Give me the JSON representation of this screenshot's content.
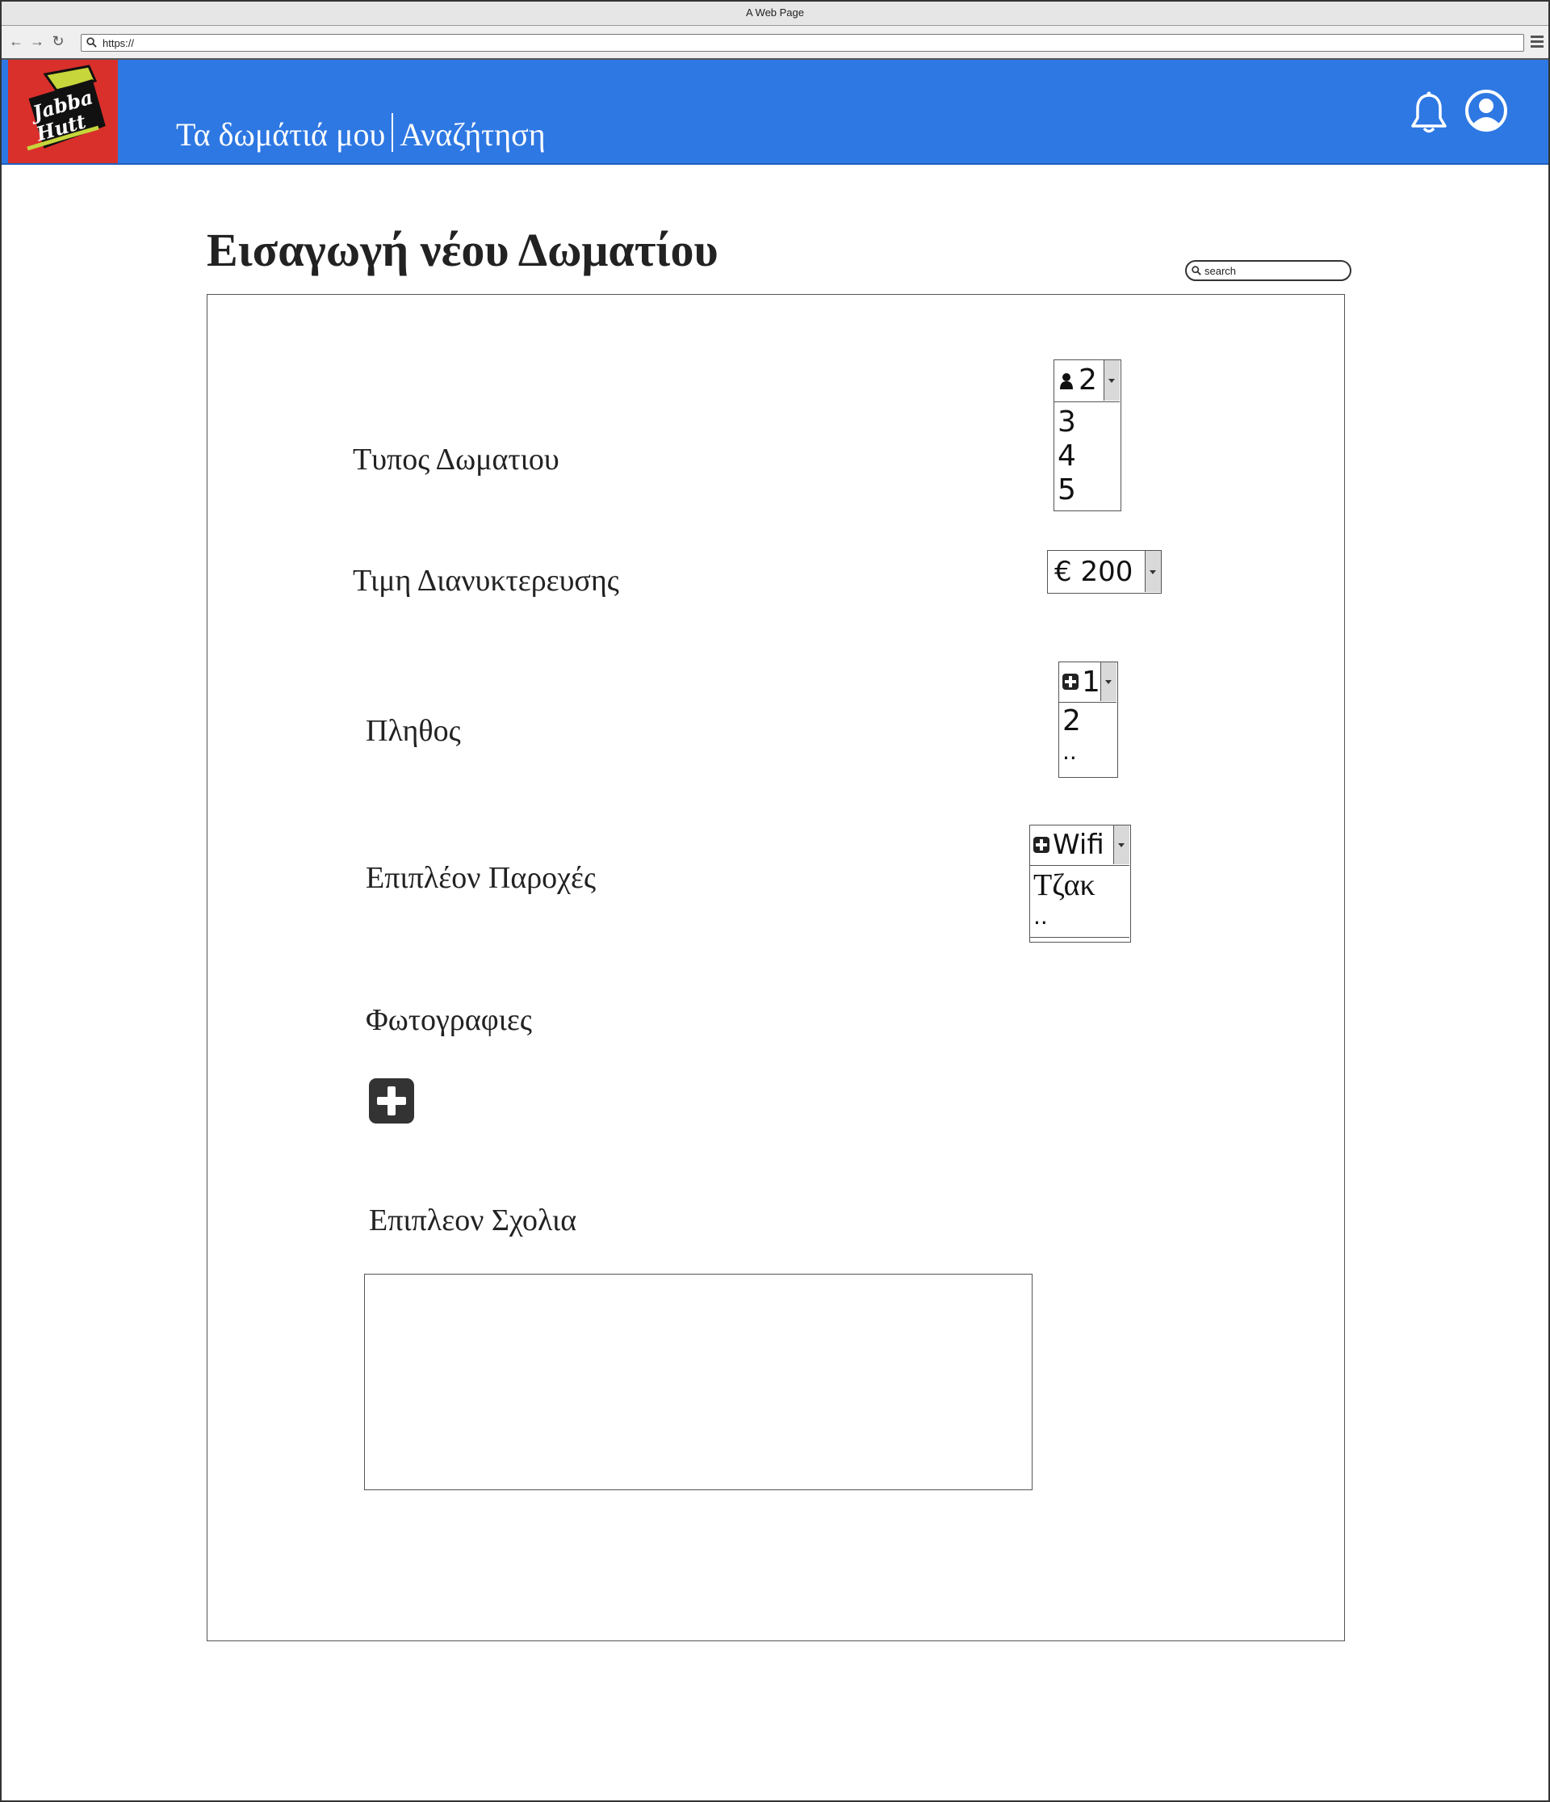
{
  "browser": {
    "window_title": "A Web Page",
    "url": "https://"
  },
  "header": {
    "logo_text": "Jabba Hutt",
    "nav": [
      "Τα δωμάτιά μου",
      "Αναζήτηση"
    ],
    "icons": [
      "bell-icon",
      "user-account-icon"
    ],
    "brand_color": "#2e78e3",
    "logo_color": "#d9302b"
  },
  "page": {
    "title": "Εισαγωγή νέου Δωματίου",
    "search_placeholder": "search"
  },
  "form": {
    "room_type": {
      "label": "Τυπος Δωματιου",
      "icon": "person-icon",
      "selected": "2",
      "options": [
        "3",
        "4",
        "5"
      ]
    },
    "price": {
      "label": "Τιμη Διανυκτερευσης",
      "selected": "€ 200"
    },
    "quantity": {
      "label": "Πληθος",
      "icon": "plus-square-icon",
      "selected": "1",
      "options": [
        "2",
        ".."
      ]
    },
    "amenities": {
      "label": "Επιπλέον Παροχές",
      "icon": "plus-square-icon",
      "selected": "Wifi",
      "options": [
        "Τζακ",
        ".."
      ]
    },
    "photos": {
      "label": "Φωτογραφιες",
      "add_icon": "plus-square-icon"
    },
    "comments": {
      "label": "Επιπλεον Σχολια",
      "value": ""
    }
  }
}
